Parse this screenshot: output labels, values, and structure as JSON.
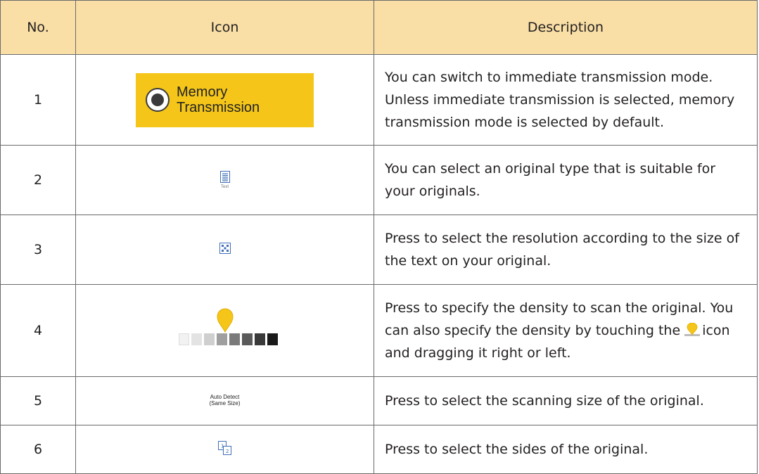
{
  "table": {
    "headers": {
      "no": "No.",
      "icon": "Icon",
      "description": "Description"
    },
    "rows": [
      {
        "no": "1",
        "icon_name": "memory-transmission-radio-icon",
        "icon_label_line1": "Memory",
        "icon_label_line2": "Transmission",
        "description": "You can switch to immediate transmission mode. Unless immediate transmission is selected, memory transmission mode is selected by default."
      },
      {
        "no": "2",
        "icon_name": "text-original-icon",
        "icon_caption": "Text",
        "description": "You can select an original type that is suitable for your originals."
      },
      {
        "no": "3",
        "icon_name": "resolution-icon",
        "description": "Press to select the resolution according to the size of the text on your original."
      },
      {
        "no": "4",
        "icon_name": "density-slider-icon",
        "description_part1": "Press to specify the density to scan the original. You can also specify the density by touching the",
        "description_part2": "icon and dragging it right or left."
      },
      {
        "no": "5",
        "icon_name": "auto-detect-size-icon",
        "icon_label_line1": "Auto Detect",
        "icon_label_line2": "(Same Size)",
        "description": "Press to select the scanning size of the original."
      },
      {
        "no": "6",
        "icon_name": "original-sides-icon",
        "icon_digit1": "1",
        "icon_digit2": "2",
        "description": "Press to select the sides of the original."
      }
    ]
  },
  "colors": {
    "header_background": "#f9dfa6",
    "memory_button": "#f5c619",
    "marker": "#f5c619",
    "icon_blue": "#3f6fb5",
    "border": "#6a6a6a"
  }
}
